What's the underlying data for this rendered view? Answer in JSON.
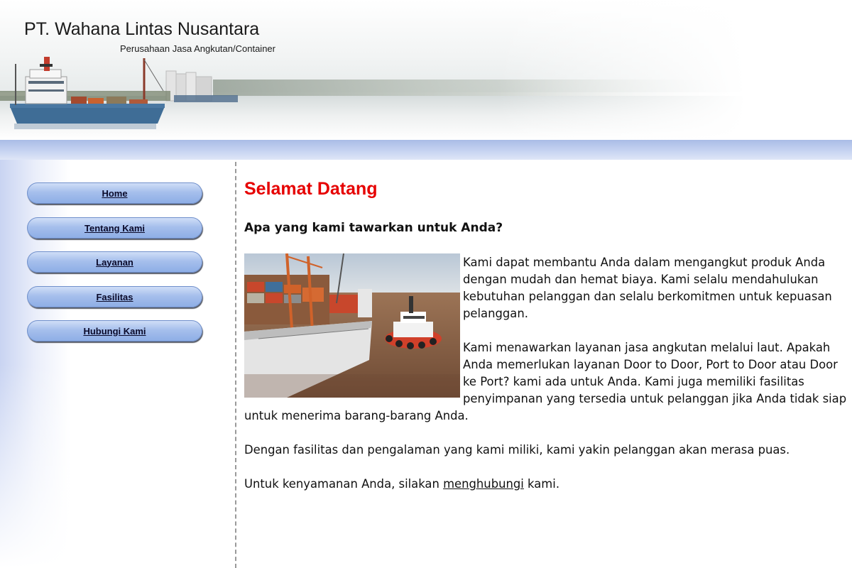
{
  "header": {
    "company_name": "PT. Wahana Lintas Nusantara",
    "tagline": "Perusahaan Jasa Angkutan/Container"
  },
  "nav": {
    "items": [
      {
        "label": "Home"
      },
      {
        "label": "Tentang Kami"
      },
      {
        "label": "Layanan"
      },
      {
        "label": "Fasilitas"
      },
      {
        "label": "Hubungi Kami"
      }
    ]
  },
  "main": {
    "title": "Selamat Datang",
    "subtitle": "Apa yang kami tawarkan untuk Anda?",
    "paragraph1": "Kami dapat membantu Anda dalam mengangkut produk Anda dengan mudah dan hemat biaya. Kami selalu mendahulukan kebutuhan pelanggan dan selalu berkomitmen untuk kepuasan pelanggan.",
    "paragraph2": "Kami menawarkan layanan jasa angkutan melalui laut. Apakah Anda memerlukan layanan Door to Door, Port to Door atau Door ke Port? kami ada untuk Anda. Kami juga memiliki fasilitas penyimpanan yang tersedia untuk pelanggan jika Anda tidak siap untuk menerima barang-barang Anda.",
    "paragraph3": "Dengan fasilitas dan pengalaman yang kami miliki, kami yakin pelanggan akan merasa puas.",
    "closing_prefix": "Untuk kenyamanan Anda, silakan ",
    "closing_link": "menghubungi",
    "closing_suffix": " kami."
  },
  "colors": {
    "title_red": "#e60000",
    "nav_blue": "#a6bfec",
    "band_blue": "#a9bce6"
  }
}
